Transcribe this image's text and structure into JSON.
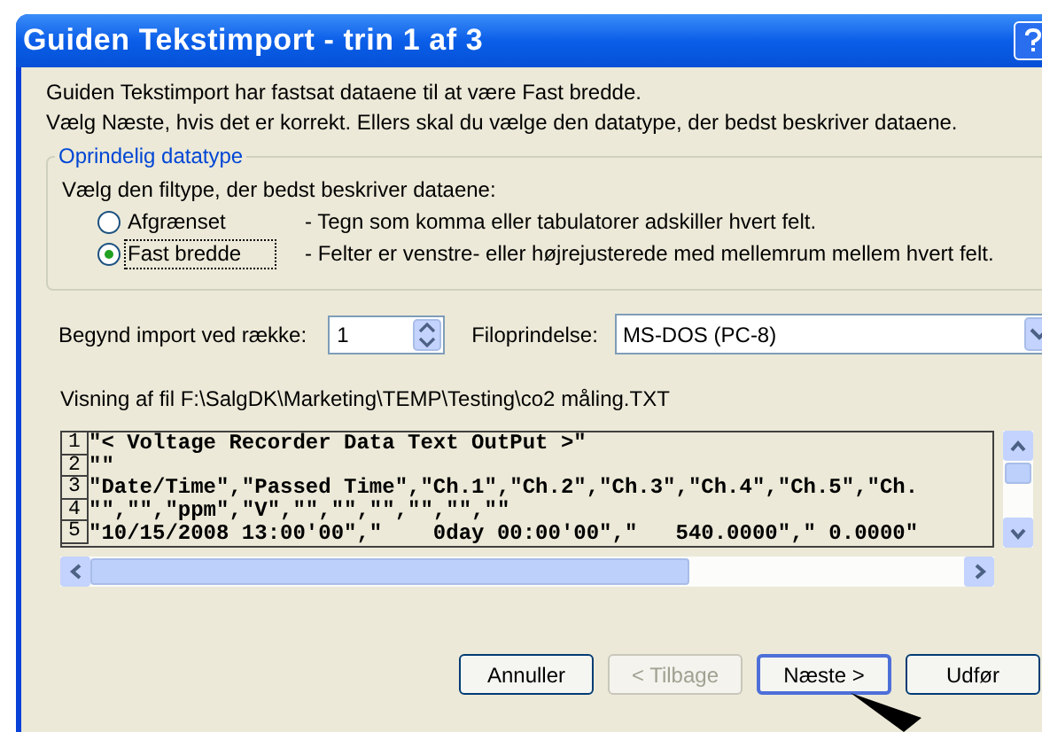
{
  "window": {
    "title": "Guiden Tekstimport - trin 1 af 3"
  },
  "intro": [
    "Guiden Tekstimport har fastsat dataene til at være Fast bredde.",
    "Vælg Næste, hvis det er korrekt. Ellers skal du vælge den datatype, der bedst beskriver dataene."
  ],
  "group": {
    "legend": "Oprindelig datatype",
    "prompt": "Vælg den filtype, der bedst beskriver dataene:",
    "options": [
      {
        "label": "Afgrænset",
        "description": "- Tegn som komma eller tabulatorer adskiller hvert felt.",
        "selected": false
      },
      {
        "label": "Fast bredde",
        "description": "- Felter er venstre- eller højrejusterede med mellemrum mellem hvert felt.",
        "selected": true
      }
    ]
  },
  "start_row": {
    "label": "Begynd import ved række:",
    "value": "1"
  },
  "file_origin": {
    "label": "Filoprindelse:",
    "value": "MS-DOS (PC-8)"
  },
  "preview": {
    "caption": "Visning af fil F:\\SalgDK\\Marketing\\TEMP\\Testing\\co2 måling.TXT",
    "lines": [
      {
        "number": "1",
        "text": "\"< Voltage Recorder Data Text OutPut >\""
      },
      {
        "number": "2",
        "text": "\"\""
      },
      {
        "number": "3",
        "text": "\"Date/Time\",\"Passed Time\",\"Ch.1\",\"Ch.2\",\"Ch.3\",\"Ch.4\",\"Ch.5\",\"Ch."
      },
      {
        "number": "4",
        "text": "\"\",\"\",\"ppm\",\"V\",\"\",\"\",\"\",\"\",\"\",\"\""
      },
      {
        "number": "5",
        "text": "\"10/15/2008 13:00'00\",\"    0day 00:00'00\",\"   540.0000\",\" 0.0000\""
      }
    ]
  },
  "buttons": [
    {
      "label": "Annuller",
      "disabled": false,
      "default": false
    },
    {
      "label": "< Tilbage",
      "disabled": true,
      "default": false
    },
    {
      "label": "Næste >",
      "disabled": false,
      "default": true
    },
    {
      "label": "Udfør",
      "disabled": false,
      "default": false
    }
  ]
}
